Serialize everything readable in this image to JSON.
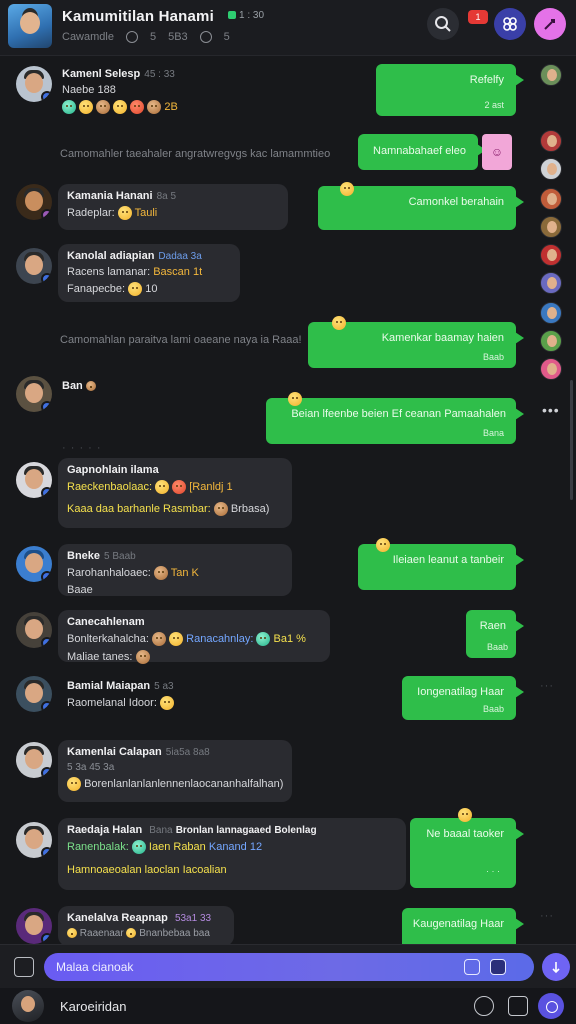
{
  "header": {
    "title": "Kamumitilan Hanami",
    "status": "1 : 30",
    "subtitle": "Cawamdle",
    "sub_counts": [
      "5",
      "5B3",
      "5"
    ],
    "notif_badge": "1"
  },
  "messages": [
    {
      "kind": "in",
      "name": "Kamenl Selesp",
      "meta": "45 : 33",
      "line1": "Naebe 188",
      "emoji_count": "2B"
    },
    {
      "kind": "out",
      "text": "Refelfy",
      "ts": "2 ast"
    },
    {
      "kind": "sys",
      "text": "Camomahler taeahaler angratwregvgs kac lamammtieo"
    },
    {
      "kind": "out",
      "text": "Namnabahaef eleo"
    },
    {
      "kind": "in",
      "name": "Kamania Hanani",
      "meta": "8a 5",
      "line1": "Radeplar:",
      "line1b": "Tauli"
    },
    {
      "kind": "out",
      "text": "Camonkel berahain"
    },
    {
      "kind": "in",
      "name": "Kanolal adiapian",
      "meta": "Dadaa 3a",
      "line1": "Racens lamanar:",
      "line1b": "Bascan 1t",
      "line2": "Fanapecbe:",
      "line2b": "10"
    },
    {
      "kind": "sys",
      "text": "Camomahlan paraitva lami oaeane naya ia Raaa!"
    },
    {
      "kind": "out",
      "text": "Kamenkar baamay haien",
      "ts": "Baab"
    },
    {
      "kind": "in",
      "name": "Ban",
      "meta": ""
    },
    {
      "kind": "out",
      "text": "Beian lfeenbe beien Ef ceanan Pamaahalen",
      "ts": "Bana"
    },
    {
      "kind": "in",
      "name": "Gapnohlain ilama",
      "line1": "Raeckenbaolaac:",
      "line1b": "[Ranldj 1",
      "line2": "Kaaa daa barhanle Rasmbar:",
      "line2b": "Brbasa)"
    },
    {
      "kind": "out",
      "text": "Ileiaen leanut a tanbeir"
    },
    {
      "kind": "in",
      "name": "Bneke",
      "meta": "5 Baab",
      "line1": "Rarohanhaloaec:",
      "line1b": "Tan K",
      "line2": "Baae"
    },
    {
      "kind": "out",
      "text": "Raen",
      "ts": "Baab"
    },
    {
      "kind": "in",
      "name": "Canecahlenam",
      "line1": "Bonlterkahalcha:",
      "line1b": "Ranacahnlay:",
      "line1c": "Ba1 %",
      "line2": "Maliae tanes:"
    },
    {
      "kind": "out",
      "text": "Iongenatilag Haar",
      "ts": "Baab"
    },
    {
      "kind": "in",
      "name": "Bamial Maiapan",
      "meta": "5 a3",
      "line1": "Raomelanal Idoor:"
    },
    {
      "kind": "in",
      "name": "Kamenlai Calapan",
      "meta": "5ia5a 8a8",
      "line1": "5 3a 45 3a",
      "line2": "Borenlanlanlanlennenlaocananhalfalhan)"
    },
    {
      "kind": "in",
      "name": "Raedaja Halan",
      "meta": "Bana",
      "line1": "Ranenbalak:",
      "line1b": "Iaen Raban",
      "line1c": "Kanand 12",
      "line2": "Hamnoaeoalan laoclan Iacoalian",
      "extra": "Bronlan lannagaaed",
      "extra2": "Bolenlag"
    },
    {
      "kind": "out",
      "text": "Ne baaal taoker"
    },
    {
      "kind": "in",
      "name": "Kanelalva Reapnap",
      "meta": "53a1 33",
      "line1": "Raaenaar",
      "line1b": "Bnanbebaa baa"
    },
    {
      "kind": "out",
      "text": "Kaugenatilag Haar"
    }
  ],
  "composer": {
    "placeholder": "Malaa cianoak"
  },
  "bottom": {
    "name": "Karoeiridan"
  }
}
